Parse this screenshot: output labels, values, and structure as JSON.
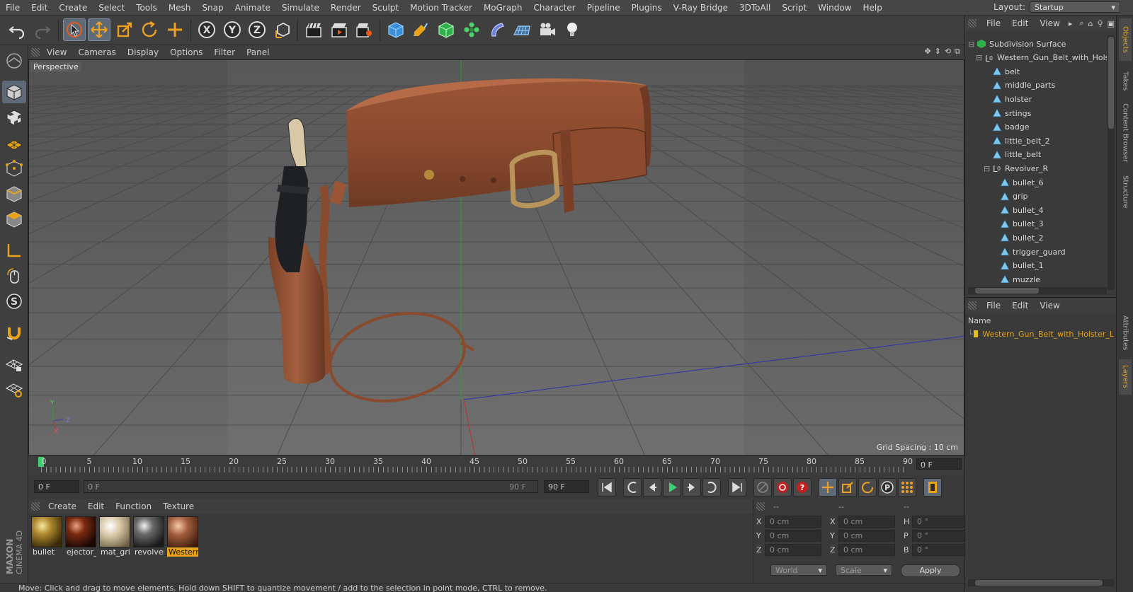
{
  "menubar": {
    "items": [
      "File",
      "Edit",
      "Create",
      "Select",
      "Tools",
      "Mesh",
      "Snap",
      "Animate",
      "Simulate",
      "Render",
      "Sculpt",
      "Motion Tracker",
      "MoGraph",
      "Character",
      "Pipeline",
      "Plugins",
      "V-Ray Bridge",
      "3DToAll",
      "Script",
      "Window",
      "Help"
    ],
    "layout_label": "Layout:",
    "layout_value": "Startup"
  },
  "viewport": {
    "menu": [
      "View",
      "Cameras",
      "Display",
      "Options",
      "Filter",
      "Panel"
    ],
    "label": "Perspective",
    "grid_spacing": "Grid Spacing : 10 cm",
    "axis_y": "Y",
    "axis_z": "Z",
    "axis_x": "X"
  },
  "timeline": {
    "ticks": [
      "0",
      "5",
      "10",
      "15",
      "20",
      "25",
      "30",
      "35",
      "40",
      "45",
      "50",
      "55",
      "60",
      "65",
      "70",
      "75",
      "80",
      "85",
      "90"
    ],
    "current_frame": "0 F"
  },
  "transport": {
    "start_field": "0 F",
    "range_start": "0 F",
    "range_end": "90 F",
    "end_field": "90 F"
  },
  "materials": {
    "menu": [
      "Create",
      "Edit",
      "Function",
      "Texture"
    ],
    "items": [
      {
        "name": "bullet"
      },
      {
        "name": "ejector_"
      },
      {
        "name": "mat_grip"
      },
      {
        "name": "revolver"
      },
      {
        "name": "Westerr"
      }
    ]
  },
  "coords": {
    "col_headers": [
      "--",
      "--",
      "--"
    ],
    "rows": [
      {
        "a": "X",
        "av": "0 cm",
        "b": "X",
        "bv": "0 cm",
        "c": "H",
        "cv": "0 °"
      },
      {
        "a": "Y",
        "av": "0 cm",
        "b": "Y",
        "bv": "0 cm",
        "c": "P",
        "cv": "0 °"
      },
      {
        "a": "Z",
        "av": "0 cm",
        "b": "Z",
        "bv": "0 cm",
        "c": "B",
        "cv": "0 °"
      }
    ],
    "mode1": "World",
    "mode2": "Scale",
    "apply": "Apply"
  },
  "status": "Move: Click and drag to move elements. Hold down SHIFT to quantize movement / add to the selection in point mode, CTRL to remove.",
  "objects": {
    "menu": [
      "File",
      "Edit",
      "View"
    ],
    "tree": [
      {
        "label": "Subdivision Surface",
        "depth": 0,
        "type": "sds"
      },
      {
        "label": "Western_Gun_Belt_with_Holst",
        "depth": 1,
        "type": "null"
      },
      {
        "label": "belt",
        "depth": 2,
        "type": "poly"
      },
      {
        "label": "middle_parts",
        "depth": 2,
        "type": "poly"
      },
      {
        "label": "holster",
        "depth": 2,
        "type": "poly"
      },
      {
        "label": "srtings",
        "depth": 2,
        "type": "poly"
      },
      {
        "label": "badge",
        "depth": 2,
        "type": "poly"
      },
      {
        "label": "little_belt_2",
        "depth": 2,
        "type": "poly"
      },
      {
        "label": "little_belt",
        "depth": 2,
        "type": "poly"
      },
      {
        "label": "Revolver_R",
        "depth": 2,
        "type": "null"
      },
      {
        "label": "bullet_6",
        "depth": 3,
        "type": "poly"
      },
      {
        "label": "grip",
        "depth": 3,
        "type": "poly"
      },
      {
        "label": "bullet_4",
        "depth": 3,
        "type": "poly"
      },
      {
        "label": "bullet_3",
        "depth": 3,
        "type": "poly"
      },
      {
        "label": "bullet_2",
        "depth": 3,
        "type": "poly"
      },
      {
        "label": "trigger_guard",
        "depth": 3,
        "type": "poly"
      },
      {
        "label": "bullet_1",
        "depth": 3,
        "type": "poly"
      },
      {
        "label": "muzzle",
        "depth": 3,
        "type": "poly"
      }
    ]
  },
  "layers": {
    "menu": [
      "File",
      "Edit",
      "View"
    ],
    "header": "Name",
    "row": "Western_Gun_Belt_with_Holster_L",
    "row_color": "#e0c020"
  },
  "right_tabs": [
    "Objects",
    "Takes",
    "Content Browser",
    "Structure",
    "Attributes",
    "Layers"
  ],
  "brand": "MAXON CINEMA 4D",
  "colors": {
    "accent": "#e8a317",
    "active_tool": "#5e6a78"
  }
}
